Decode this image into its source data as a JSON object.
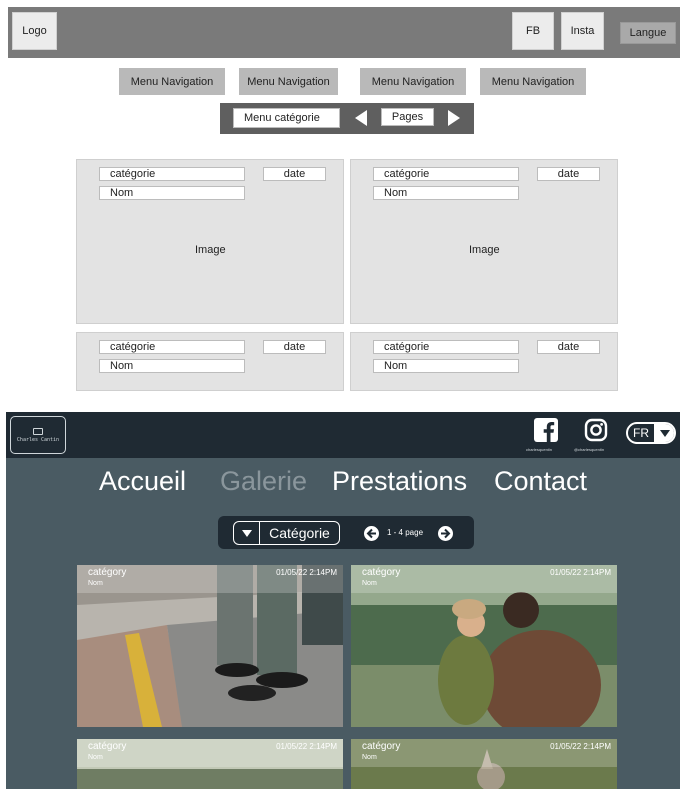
{
  "wireframe": {
    "logo_label": "Logo",
    "fb_label": "FB",
    "insta_label": "Insta",
    "langue_label": "Langue",
    "nav_items": [
      "Menu Navigation",
      "Menu Navigation",
      "Menu Navigation",
      "Menu Navigation"
    ],
    "category_menu_label": "Menu catégorie",
    "pages_label": "Pages",
    "cards": [
      {
        "categorie": "catégorie",
        "date": "date",
        "nom": "Nom",
        "image": "Image"
      },
      {
        "categorie": "catégorie",
        "date": "date",
        "nom": "Nom",
        "image": "Image"
      },
      {
        "categorie": "catégorie",
        "date": "date",
        "nom": "Nom"
      },
      {
        "categorie": "catégorie",
        "date": "date",
        "nom": "Nom"
      }
    ]
  },
  "mockup": {
    "logo_text": "Charles Cantin",
    "social": {
      "facebook_icon": "facebook-icon",
      "instagram_icon": "instagram-icon",
      "facebook_handle": "charlesquentin",
      "instagram_handle": "@charlesquentin"
    },
    "lang_label": "FR",
    "nav": {
      "accueil": "Accueil",
      "galerie": "Galerie",
      "prestations": "Prestations",
      "contact": "Contact"
    },
    "category_select_label": "Catégorie",
    "pages_label": "1 - 4 page",
    "cards": [
      {
        "category": "catégory",
        "nom": "Nom",
        "date": "01/05/22 2:14PM"
      },
      {
        "category": "catégory",
        "nom": "Nom",
        "date": "01/05/22 2:14PM"
      },
      {
        "category": "catégory",
        "nom": "Nom",
        "date": "01/05/22 2:14PM"
      },
      {
        "category": "catégory",
        "nom": "Nom",
        "date": "01/05/22 2:14PM"
      }
    ],
    "colors": {
      "header": "#1f2a33",
      "background": "#4a5b63",
      "active_nav": "#8a969c"
    }
  }
}
